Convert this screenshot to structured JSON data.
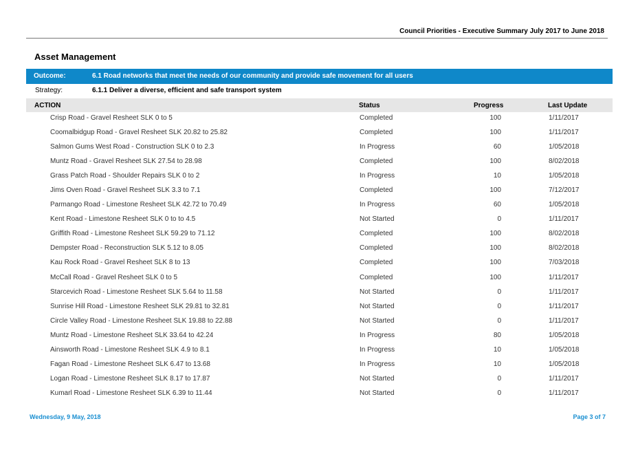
{
  "header": {
    "title": "Council Priorities - Executive Summary  July 2017 to June 2018"
  },
  "section": {
    "title": "Asset Management"
  },
  "outcome": {
    "label": "Outcome:",
    "text": "6.1  Road networks that meet the needs of our community and provide safe movement for all users"
  },
  "strategy": {
    "label": "Strategy:",
    "text": "6.1.1  Deliver a diverse, efficient and safe transport system"
  },
  "colors": {
    "outcome_bar": "#0f88c9",
    "footer_text": "#1a8fd1",
    "header_row": "#e6e6e6"
  },
  "table": {
    "columns": {
      "action": "ACTION",
      "status": "Status",
      "progress": "Progress",
      "update": "Last Update"
    },
    "rows": [
      {
        "action": "Crisp Road - Gravel Resheet SLK 0 to 5",
        "status": "Completed",
        "progress": "100",
        "update": "1/11/2017"
      },
      {
        "action": "Coomalbidgup Road - Gravel Resheet SLK 20.82 to 25.82",
        "status": "Completed",
        "progress": "100",
        "update": "1/11/2017"
      },
      {
        "action": "Salmon Gums West Road - Construction SLK 0 to 2.3",
        "status": "In Progress",
        "progress": "60",
        "update": "1/05/2018"
      },
      {
        "action": "Muntz Road - Gravel Resheet SLK 27.54 to 28.98",
        "status": "Completed",
        "progress": "100",
        "update": "8/02/2018"
      },
      {
        "action": "Grass Patch Road - Shoulder Repairs SLK 0 to 2",
        "status": "In Progress",
        "progress": "10",
        "update": "1/05/2018"
      },
      {
        "action": "Jims Oven Road - Gravel Resheet SLK 3.3 to 7.1",
        "status": "Completed",
        "progress": "100",
        "update": "7/12/2017"
      },
      {
        "action": "Parmango Road - Limestone Resheet SLK 42.72 to 70.49",
        "status": "In Progress",
        "progress": "60",
        "update": "1/05/2018"
      },
      {
        "action": "Kent Road - Limestone Resheet SLK 0 to to 4.5",
        "status": "Not Started",
        "progress": "0",
        "update": "1/11/2017"
      },
      {
        "action": "Griffith Road - Limestone Resheet SLK 59.29 to 71.12",
        "status": "Completed",
        "progress": "100",
        "update": "8/02/2018"
      },
      {
        "action": "Dempster Road - Reconstruction SLK 5.12 to 8.05",
        "status": "Completed",
        "progress": "100",
        "update": "8/02/2018"
      },
      {
        "action": "Kau Rock Road - Gravel Resheet SLK 8 to 13",
        "status": "Completed",
        "progress": "100",
        "update": "7/03/2018"
      },
      {
        "action": "McCall Road - Gravel Resheet SLK 0 to 5",
        "status": "Completed",
        "progress": "100",
        "update": "1/11/2017"
      },
      {
        "action": "Starcevich Road - Limestone Resheet SLK 5.64 to 11.58",
        "status": "Not Started",
        "progress": "0",
        "update": "1/11/2017"
      },
      {
        "action": "Sunrise Hill Road - Limestone Resheet SLK 29.81 to 32.81",
        "status": "Not Started",
        "progress": "0",
        "update": "1/11/2017"
      },
      {
        "action": "Circle Valley Road - Limestone Resheet SLK 19.88 to 22.88",
        "status": "Not Started",
        "progress": "0",
        "update": "1/11/2017"
      },
      {
        "action": "Muntz Road - Limestone Resheet SLK 33.64 to 42.24",
        "status": "In Progress",
        "progress": "80",
        "update": "1/05/2018"
      },
      {
        "action": "Ainsworth Road - Limestone Resheet SLK 4.9 to 8.1",
        "status": "In Progress",
        "progress": "10",
        "update": "1/05/2018"
      },
      {
        "action": "Fagan Road - Limestone Resheet SLK 6.47 to 13.68",
        "status": "In Progress",
        "progress": "10",
        "update": "1/05/2018"
      },
      {
        "action": "Logan Road - Limestone Resheet SLK 8.17 to 17.87",
        "status": "Not Started",
        "progress": "0",
        "update": "1/11/2017"
      },
      {
        "action": "Kumarl Road - Limestone Resheet SLK 6.39 to 11.44",
        "status": "Not Started",
        "progress": "0",
        "update": "1/11/2017"
      }
    ]
  },
  "footer": {
    "date": "Wednesday, 9 May, 2018",
    "page": "Page 3 of 7"
  }
}
